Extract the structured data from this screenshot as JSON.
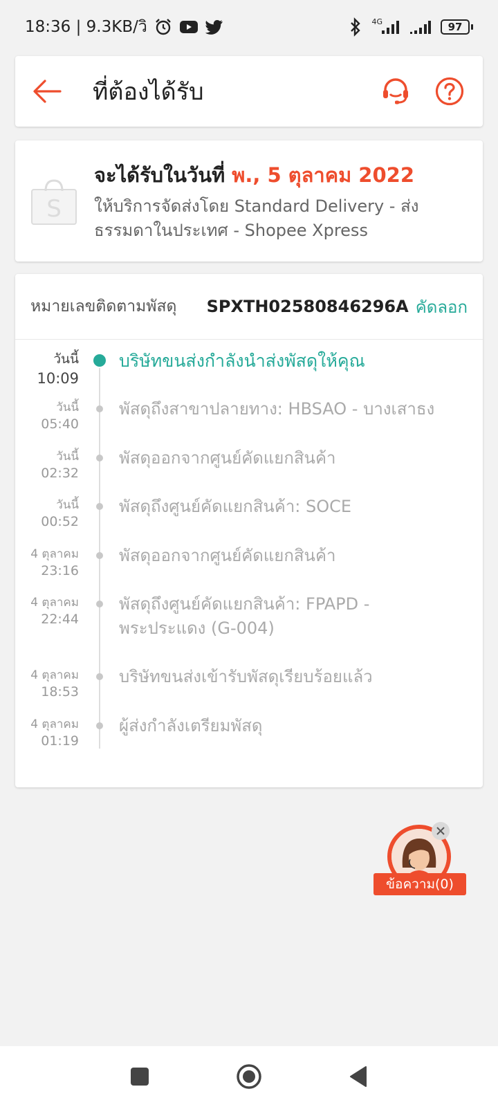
{
  "status_bar": {
    "time_speed": "18:36 | 9.3KB/วิ",
    "network_label": "4G",
    "battery": "97",
    "icons": [
      "alarm-icon",
      "youtube-icon",
      "twitter-icon",
      "bluetooth-icon",
      "signal-icon",
      "signal-icon",
      "battery-icon"
    ]
  },
  "header": {
    "title": "ที่ต้องได้รับ",
    "icons": [
      "back-arrow-icon",
      "headset-icon",
      "help-icon"
    ],
    "accent_color": "#ee4d2d"
  },
  "delivery": {
    "eta_label": "จะได้รับในวันที่ ",
    "eta_date": "พ., 5 ตุลาคม 2022",
    "service_text": "ให้บริการจัดส่งโดย Standard Delivery - ส่งธรรมดาในประเทศ - Shopee Xpress"
  },
  "tracking": {
    "label": "หมายเลขติดตามพัสดุ",
    "number": "SPXTH02580846296A",
    "copy_label": "คัดลอก",
    "accent_color": "#26aa99",
    "events": [
      {
        "date": "วันนี้",
        "time": "10:09",
        "text": "บริษัทขนส่งกำลังนำส่งพัสดุให้คุณ"
      },
      {
        "date": "วันนี้",
        "time": "05:40",
        "text": "พัสดุถึงสาขาปลายทาง: HBSAO - บางเสาธง"
      },
      {
        "date": "วันนี้",
        "time": "02:32",
        "text": "พัสดุออกจากศูนย์คัดแยกสินค้า"
      },
      {
        "date": "วันนี้",
        "time": "00:52",
        "text": "พัสดุถึงศูนย์คัดแยกสินค้า: SOCE"
      },
      {
        "date": "4 ตุลาคม",
        "time": "23:16",
        "text": "พัสดุออกจากศูนย์คัดแยกสินค้า"
      },
      {
        "date": "4 ตุลาคม",
        "time": "22:44",
        "text": "พัสดุถึงศูนย์คัดแยกสินค้า: FPAPD - พระประแดง (G-004)"
      },
      {
        "date": "4 ตุลาคม",
        "time": "18:53",
        "text": "บริษัทขนส่งเข้ารับพัสดุเรียบร้อยแล้ว"
      },
      {
        "date": "4 ตุลาคม",
        "time": "01:19",
        "text": "ผู้ส่งกำลังเตรียมพัสดุ"
      }
    ]
  },
  "chat": {
    "label": "ข้อความ(0)"
  },
  "nav": {
    "icons": [
      "recent-apps-icon",
      "home-icon",
      "back-icon"
    ]
  }
}
